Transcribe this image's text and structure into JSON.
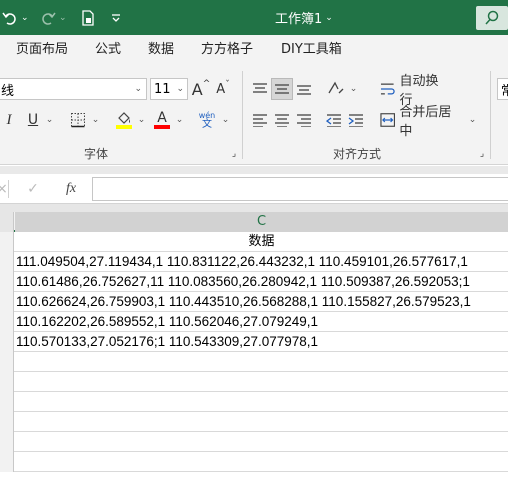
{
  "titlebar": {
    "title": "工作簿1",
    "undo_icon": "undo-icon",
    "redo_icon": "redo-icon",
    "newfile_icon": "new-file-icon",
    "customize_icon": "customize-toolbar-icon",
    "search_icon": "search-icon",
    "title_dropdown": "⌄"
  },
  "tabs": [
    "页面布局",
    "公式",
    "数据",
    "方方格子",
    "DIY工具箱"
  ],
  "ribbon": {
    "font_name": "线",
    "font_size": "11",
    "grow_font": "A",
    "shrink_font": "A",
    "italic": "I",
    "underline": "U",
    "font_color_letter": "A",
    "pinyin_top": "wén",
    "pinyin_bottom": "文",
    "font_group_label": "字体",
    "wrap_text": "自动换行",
    "merge_center": "合并后居中",
    "align_group_label": "对齐方式",
    "number_format_partial": "常",
    "highlight_color": "#ffff00",
    "font_color": "#ff0000"
  },
  "formula_bar": {
    "cancel": "×",
    "confirm": "✓",
    "fx": "fx",
    "value": ""
  },
  "sheet": {
    "column_header": "C",
    "header_cell": "数据",
    "rows": [
      "111.049504,27.119434,1 110.831122,26.443232,1 110.459101,26.577617,1",
      "110.61486,26.752627,11 110.083560,26.280942,1 110.509387,26.592053;1",
      "110.626624,26.759903,1 110.443510,26.568288,1 110.155827,26.579523,1",
      "110.162202,26.589552,1 110.562046,27.079249,1",
      "110.570133,27.052176;1 110.543309,27.077978,1"
    ]
  }
}
